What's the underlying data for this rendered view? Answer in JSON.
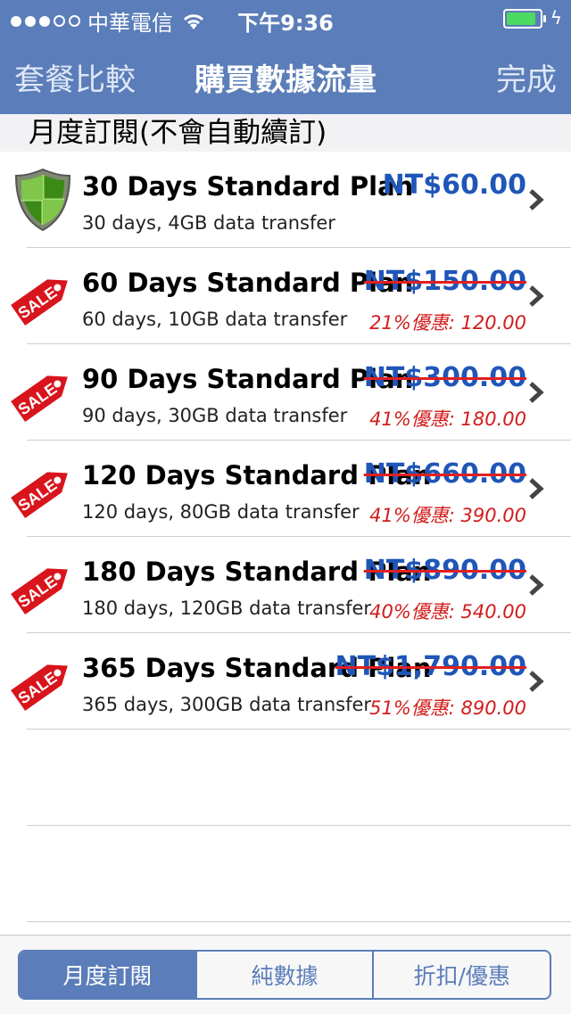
{
  "status": {
    "carrier": "中華電信",
    "time": "下午9:36"
  },
  "nav": {
    "left": "套餐比較",
    "title": "購買數據流量",
    "right": "完成"
  },
  "section_header": "月度訂閱(不會自動續訂)",
  "plans": [
    {
      "title": "30 Days Standard Plan",
      "desc": "30 days, 4GB data transfer",
      "price": "NT$60.00",
      "discount": "",
      "icon": "shield-icon",
      "strike": false
    },
    {
      "title": "60 Days Standard Plan",
      "desc": "60 days, 10GB data transfer",
      "price": "NT$150.00",
      "discount": "21%優惠: 120.00",
      "icon": "sale-tag-icon",
      "strike": true
    },
    {
      "title": "90 Days Standard Plan",
      "desc": "90 days, 30GB data transfer",
      "price": "NT$300.00",
      "discount": "41%優惠: 180.00",
      "icon": "sale-tag-icon",
      "strike": true
    },
    {
      "title": "120 Days Standard Plan",
      "desc": "120 days, 80GB data transfer",
      "price": "NT$660.00",
      "discount": "41%優惠: 390.00",
      "icon": "sale-tag-icon",
      "strike": true
    },
    {
      "title": "180 Days Standard Plan",
      "desc": "180 days, 120GB data transfer",
      "price": "NT$890.00",
      "discount": "40%優惠: 540.00",
      "icon": "sale-tag-icon",
      "strike": true
    },
    {
      "title": "365 Days Standard Plan",
      "desc": "365 days, 300GB data transfer",
      "price": "NT$1,790.00",
      "discount": "51%優惠: 890.00",
      "icon": "sale-tag-icon",
      "strike": true
    }
  ],
  "sale_label": "SALE",
  "tabs": [
    {
      "label": "月度訂閱",
      "active": true
    },
    {
      "label": "純數據",
      "active": false
    },
    {
      "label": "折扣/優惠",
      "active": false
    }
  ],
  "colors": {
    "bar": "#5b7db9",
    "price": "#1f56b8",
    "discount": "#d21c1c",
    "battery": "#4cd964"
  }
}
